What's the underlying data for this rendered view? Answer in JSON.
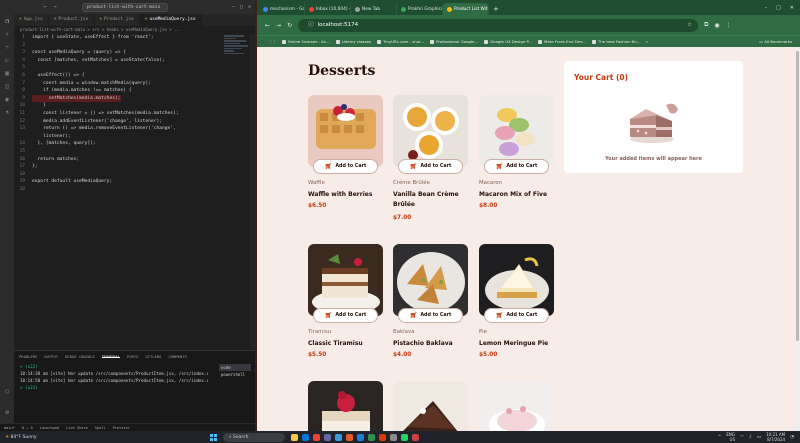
{
  "vscode": {
    "nav_back": "←",
    "nav_fwd": "→",
    "command_center": "product-list-with-cart-main",
    "tabs": [
      {
        "label": "App.jsx",
        "active": false
      },
      {
        "label": "Product.jsx",
        "active": false
      },
      {
        "label": "Product.jsx",
        "active": false
      },
      {
        "label": "useMediaQuery.jsx",
        "active": true
      }
    ],
    "breadcrumb": "product-list-with-cart-main > src > hooks > useMediaQuery.jsx > ...",
    "code_lines": [
      {
        "n": "1",
        "text": "import { useState, useEffect } from 'react';",
        "err": false
      },
      {
        "n": "2",
        "text": "",
        "err": false
      },
      {
        "n": "3",
        "text": "const useMediaQuery = (query) => {",
        "err": false
      },
      {
        "n": "4",
        "text": "  const [matches, setMatches] = useState(false);",
        "err": false
      },
      {
        "n": "5",
        "text": "",
        "err": false
      },
      {
        "n": "6",
        "text": "  useEffect(() => {",
        "err": false
      },
      {
        "n": "7",
        "text": "    const media = window.matchMedia(query);",
        "err": false
      },
      {
        "n": "8",
        "text": "    if (media.matches !== matches) {",
        "err": false
      },
      {
        "n": "9",
        "text": "      setMatches(media.matches);",
        "err": true
      },
      {
        "n": "10",
        "text": "    }",
        "err": false
      },
      {
        "n": "11",
        "text": "    const listener = () => setMatches(media.matches);",
        "err": false
      },
      {
        "n": "12",
        "text": "    media.addEventListener('change', listener);",
        "err": false
      },
      {
        "n": "13",
        "text": "    return () => media.removeEventListener('change',",
        "err": false
      },
      {
        "n": "",
        "text": "    listener);",
        "err": false
      },
      {
        "n": "14",
        "text": "  }, [matches, query]);",
        "err": false
      },
      {
        "n": "15",
        "text": "",
        "err": false
      },
      {
        "n": "16",
        "text": "  return matches;",
        "err": false
      },
      {
        "n": "17",
        "text": "};",
        "err": false
      },
      {
        "n": "18",
        "text": "",
        "err": false
      },
      {
        "n": "19",
        "text": "export default useMediaQuery;",
        "err": false
      },
      {
        "n": "20",
        "text": "",
        "err": false
      }
    ],
    "panel_tabs": [
      "PROBLEMS",
      "OUTPUT",
      "DEBUG CONSOLE",
      "TERMINAL",
      "PORTS",
      "GITLENS",
      "COMMENTS"
    ],
    "active_panel_tab": "TERMINAL",
    "terminal_lines": [
      {
        "c": "t1",
        "text": "> (x22)"
      },
      {
        "c": "t2",
        "text": "10:14:38 am [vite] hmr update /src/components/ProductItem.jsx, /src/index.css"
      },
      {
        "c": "t2",
        "text": "10:14:50 am [vite] hmr update /src/components/ProductItem.jsx, /src/index.css"
      },
      {
        "c": "t1",
        "text": "> (x23)"
      }
    ],
    "terminal_list": [
      "node",
      "powershell"
    ],
    "status_items": [
      "main*",
      "0 ⚠ 0",
      "Launchpad",
      "Live Share",
      "Spell",
      "Prettier"
    ]
  },
  "chrome": {
    "tabs": [
      {
        "label": "mechanism - Google Sea",
        "fav": "#4285f4",
        "active": false
      },
      {
        "label": "Inbox (10,604) - emmanu",
        "fav": "#ea4335",
        "active": false
      },
      {
        "label": "New Tab",
        "fav": "#9aa0a6",
        "active": false
      },
      {
        "label": "Prakhn Graphics and Digita",
        "fav": "#34a853",
        "active": false
      },
      {
        "label": "Product List With Cart",
        "fav": "#fbbc05",
        "active": true
      }
    ],
    "new_tab": "+",
    "url": "localhost:5174",
    "bookmarks": [
      "Online Courses - An...",
      "Udemy classes",
      "TinyURL.com - shor...",
      "Professional Google...",
      "Google UX Design P...",
      "Meta Front-End Dev...",
      "The best Fashion fin..."
    ],
    "all_bookmarks": "All Bookmarks"
  },
  "page": {
    "title": "Desserts",
    "add_to_cart": "Add to Cart",
    "products": [
      {
        "category": "Waffle",
        "name": "Waffle with Berries",
        "price": "$6.50"
      },
      {
        "category": "Crème Brûlée",
        "name": "Vanilla Bean Crème Brûlée",
        "price": "$7.00"
      },
      {
        "category": "Macaron",
        "name": "Macaron Mix of Five",
        "price": "$8.00"
      },
      {
        "category": "Tiramisu",
        "name": "Classic Tiramisu",
        "price": "$5.50"
      },
      {
        "category": "Baklava",
        "name": "Pistachio Baklava",
        "price": "$4.00"
      },
      {
        "category": "Pie",
        "name": "Lemon Meringue Pie",
        "price": "$5.00"
      },
      {
        "category": "",
        "name": "",
        "price": ""
      },
      {
        "category": "",
        "name": "",
        "price": ""
      },
      {
        "category": "",
        "name": "",
        "price": ""
      }
    ],
    "cart_title": "Your Cart (0)",
    "cart_empty": "Your added items will appear here"
  },
  "taskbar": {
    "weather_temp": "84°F",
    "weather_desc": "Sunny",
    "search": "Search",
    "lang": "ENG",
    "region": "US",
    "time": "10:21 AM",
    "date": "8/7/2024"
  },
  "colors": {
    "accent": "#c73b0f",
    "rose900": "#260f08",
    "rose500": "#87635a",
    "chrome_green": "#2f6b43"
  }
}
